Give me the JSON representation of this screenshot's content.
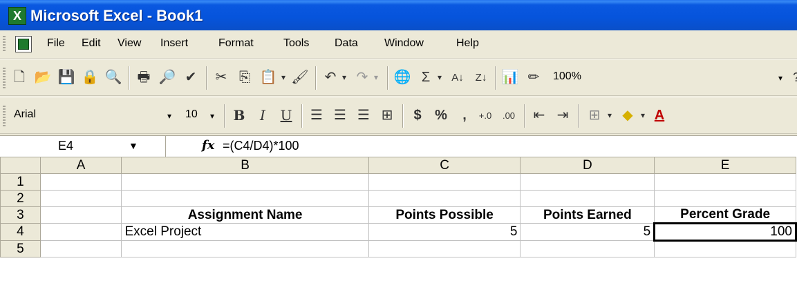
{
  "window": {
    "title": "Microsoft Excel - Book1"
  },
  "menu": [
    "File",
    "Edit",
    "View",
    "Insert",
    "Format",
    "Tools",
    "Data",
    "Window",
    "Help"
  ],
  "toolbar_standard": {
    "zoom": "100%"
  },
  "toolbar_formatting": {
    "font": "Arial",
    "font_size": "10"
  },
  "formula_bar": {
    "name_box": "E4",
    "fx_label": "fx",
    "formula": "=(C4/D4)*100"
  },
  "sheet": {
    "columns": [
      "A",
      "B",
      "C",
      "D",
      "E"
    ],
    "rows": [
      "1",
      "2",
      "3",
      "4",
      "5"
    ],
    "cells": [
      [
        "",
        "",
        "",
        "",
        ""
      ],
      [
        "",
        "",
        "",
        "",
        ""
      ],
      [
        "",
        "Assignment Name",
        "Points Possible",
        "Points Earned",
        "Percent Grade"
      ],
      [
        "",
        "Excel Project",
        "5",
        "5",
        "100"
      ],
      [
        "",
        "",
        "",
        "",
        ""
      ]
    ],
    "active_cell": "E4"
  },
  "colors": {
    "title_bar": "#0a58e0",
    "selection_header": "#bfcfe8"
  }
}
